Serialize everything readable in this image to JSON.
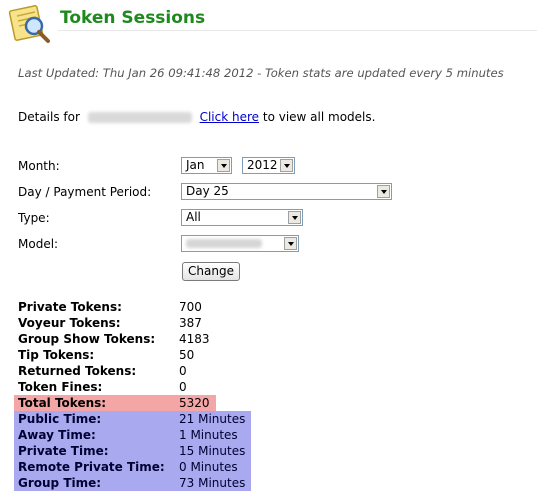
{
  "header": {
    "title": "Token Sessions",
    "logo_icon": "notepad-magnifier-icon"
  },
  "last_updated": "Last Updated: Thu Jan 26 09:41:48 2012 - Token stats are updated every 5 minutes",
  "details": {
    "prefix": "Details for",
    "link_text": "Click here",
    "suffix": "to view all models."
  },
  "form": {
    "month_label": "Month:",
    "month_value": "Jan",
    "year_value": "2012",
    "day_label": "Day / Payment Period:",
    "day_value": "Day 25",
    "type_label": "Type:",
    "type_value": "All",
    "model_label": "Model:",
    "change_button": "Change"
  },
  "stats": [
    {
      "label": "Private Tokens:",
      "value": "700"
    },
    {
      "label": "Voyeur Tokens:",
      "value": "387"
    },
    {
      "label": "Group Show Tokens:",
      "value": "4183"
    },
    {
      "label": "Tip Tokens:",
      "value": "50"
    },
    {
      "label": "Returned Tokens:",
      "value": "0"
    },
    {
      "label": "Token Fines:",
      "value": "0"
    }
  ],
  "total": {
    "label": "Total Tokens:",
    "value": "5320"
  },
  "times": [
    {
      "label": "Public Time:",
      "value": "21 Minutes"
    },
    {
      "label": "Away Time:",
      "value": "1 Minutes"
    },
    {
      "label": "Private Time:",
      "value": "15 Minutes"
    },
    {
      "label": "Remote Private Time:",
      "value": "0 Minutes"
    },
    {
      "label": "Group Time:",
      "value": "73 Minutes"
    }
  ],
  "colors": {
    "title": "#1e8a1e",
    "total_bg": "#f4a6a6",
    "time_bg": "#a9a9f0",
    "link": "#0000cc"
  }
}
